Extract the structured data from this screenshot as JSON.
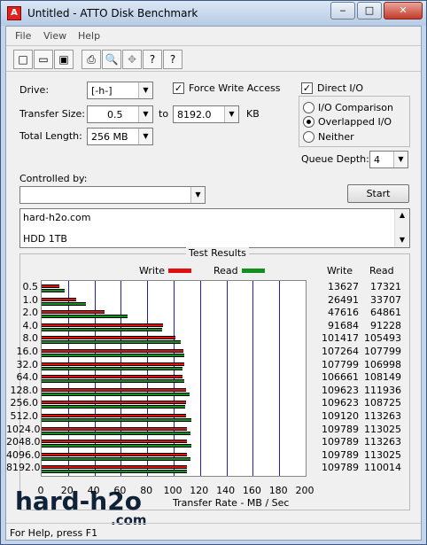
{
  "window": {
    "title": "Untitled - ATTO Disk Benchmark",
    "app_icon": "A",
    "controls": [
      "‒",
      "□",
      "✕"
    ]
  },
  "menu": [
    "File",
    "View",
    "Help"
  ],
  "toolbar": {
    "icons": [
      "new-icon",
      "open-icon",
      "save-icon",
      "print-icon",
      "print-preview-icon",
      "move-icon",
      "help-icon",
      "context-help-icon"
    ],
    "glyphs": [
      "□",
      "▭",
      "▣",
      "⎙",
      "🔍",
      "✥",
      "?",
      "?"
    ]
  },
  "settings": {
    "drive_label": "Drive:",
    "drive_value": "[-h-]",
    "transfer_size_label": "Transfer Size:",
    "transfer_from": "0.5",
    "to_label": "to",
    "transfer_to": "8192.0",
    "kb_label": "KB",
    "total_length_label": "Total Length:",
    "total_length_value": "256 MB",
    "force_write_access_label": "Force Write Access",
    "force_write_access_checked": true,
    "direct_io_label": "Direct I/O",
    "direct_io_checked": true,
    "io_comparison_label": "I/O Comparison",
    "overlapped_io_label": "Overlapped I/O",
    "neither_label": "Neither",
    "selected_io_mode": "Overlapped I/O",
    "queue_depth_label": "Queue Depth:",
    "queue_depth_value": "4",
    "controlled_by_label": "Controlled by:",
    "controlled_by_value": "",
    "start_label": "Start",
    "check_mark": "✓",
    "dropdown_arrow": "▼"
  },
  "description": {
    "lines": [
      "hard-h2o.com",
      "HDD 1TB"
    ],
    "scroll_up": "▲",
    "scroll_down": "▼"
  },
  "results": {
    "title": "Test Results",
    "write_legend": "Write",
    "read_legend": "Read",
    "write_col": "Write",
    "read_col": "Read",
    "xlabel": "Transfer Rate - MB / Sec"
  },
  "chart_data": {
    "type": "bar",
    "orientation": "horizontal",
    "categories": [
      "0.5",
      "1.0",
      "2.0",
      "4.0",
      "8.0",
      "16.0",
      "32.0",
      "64.0",
      "128.0",
      "256.0",
      "512.0",
      "1024.0",
      "2048.0",
      "4096.0",
      "8192.0"
    ],
    "series": [
      {
        "name": "Write",
        "color": "#e01010",
        "values": [
          13627,
          26491,
          47616,
          91684,
          101417,
          107264,
          107799,
          106661,
          109623,
          109623,
          109120,
          109789,
          109789,
          109789,
          109789
        ]
      },
      {
        "name": "Read",
        "color": "#14901e",
        "values": [
          17321,
          33707,
          64861,
          91228,
          105493,
          107799,
          106998,
          108149,
          111936,
          108725,
          113263,
          113025,
          113263,
          113025,
          110014
        ]
      }
    ],
    "xlabel": "Transfer Rate - MB / Sec",
    "xlim": [
      0,
      200
    ],
    "xticks": [
      0,
      20,
      40,
      60,
      80,
      100,
      120,
      140,
      160,
      180,
      200
    ],
    "grid": true,
    "legend": "top"
  },
  "status": "For Help, press F1",
  "watermark": {
    "main": "hard-h2o",
    "sub": ".com"
  }
}
